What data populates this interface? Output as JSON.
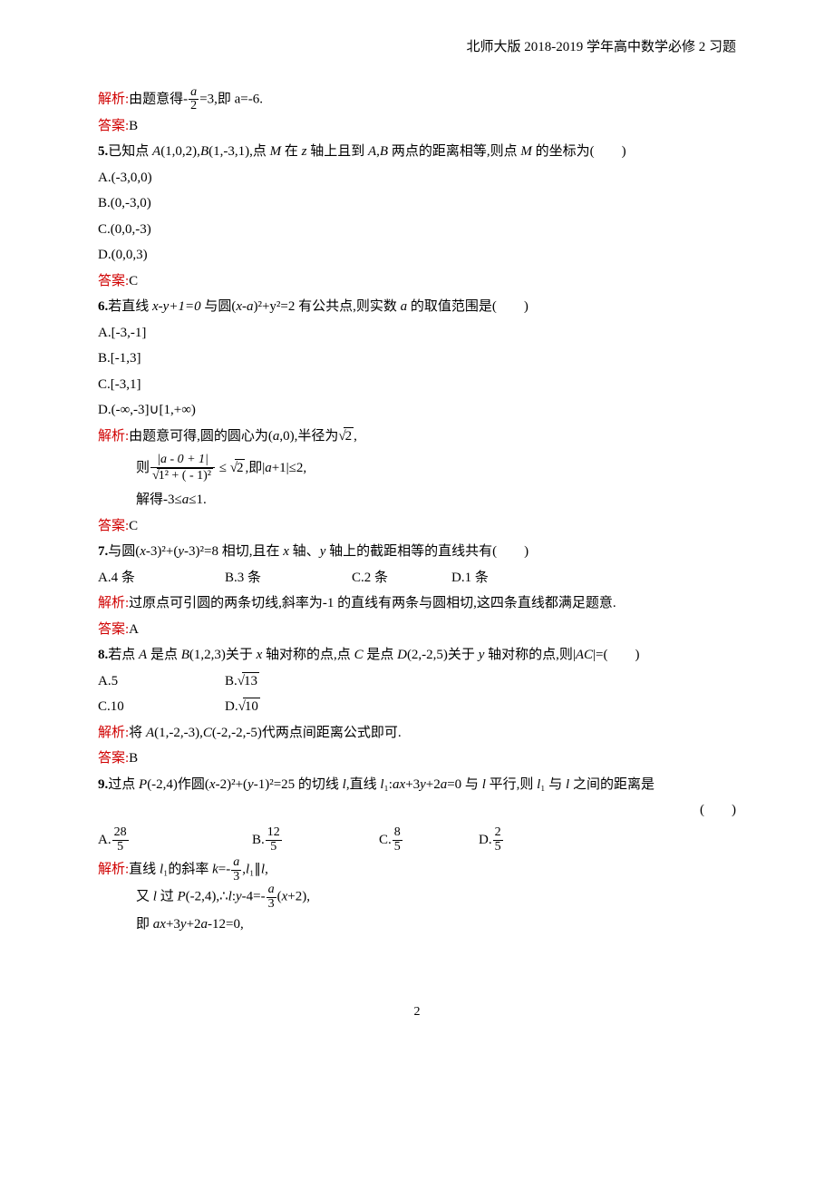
{
  "header": "北师大版 2018-2019 学年高中数学必修 2 习题",
  "q4": {
    "explain_label": "解析:",
    "explain_text_1": "由题意得-",
    "frac_num": "a",
    "frac_den": "2",
    "explain_text_2": "=3,即 a=-6.",
    "ans_label": "答案:",
    "ans_value": "B"
  },
  "q5": {
    "number": "5.",
    "stem_1": "已知点 ",
    "stem_2": "A",
    "stem_3": "(1,0,2),",
    "stem_4": "B",
    "stem_5": "(1,-3,1),点 ",
    "stem_6": "M",
    "stem_7": " 在 ",
    "stem_8": "z",
    "stem_9": " 轴上且到 ",
    "stem_10": "A,B",
    "stem_11": " 两点的距离相等,则点 ",
    "stem_12": "M",
    "stem_13": " 的坐标为(  )",
    "opt_a": "A.(-3,0,0)",
    "opt_b": "B.(0,-3,0)",
    "opt_c": "C.(0,0,-3)",
    "opt_d": "D.(0,0,3)",
    "ans_label": "答案:",
    "ans_value": "C"
  },
  "q6": {
    "number": "6.",
    "stem_pre": "若直线 ",
    "stem_eq1": "x-y+1=0",
    "stem_mid1": " 与圆(",
    "stem_eq2": "x-a",
    "stem_mid2": ")²+y²=2 有公共点,则实数 ",
    "stem_a": "a",
    "stem_post": " 的取值范围是(  )",
    "opt_a": "A.[-3,-1]",
    "opt_b": "B.[-1,3]",
    "opt_c": "C.[-3,1]",
    "opt_d": "D.(-∞,-3]∪[1,+∞)",
    "explain_label": "解析:",
    "exp_line1_a": "由题意可得,圆的圆心为(",
    "exp_line1_b": "a",
    "exp_line1_c": ",0),半径为",
    "exp_line1_sq": "2",
    "exp_line1_d": ",",
    "exp_line2_pre": "则",
    "exp_line2_num": "|a - 0 + 1|",
    "exp_line2_den_rad": "1² + ( - 1)²",
    "exp_line2_le": " ≤ ",
    "exp_line2_sq": "2",
    "exp_line2_post_a": ",即|",
    "exp_line2_post_b": "a",
    "exp_line2_post_c": "+1|≤2,",
    "exp_line3_a": "解得-3≤",
    "exp_line3_b": "a",
    "exp_line3_c": "≤1.",
    "ans_label": "答案:",
    "ans_value": "C"
  },
  "q7": {
    "number": "7.",
    "stem_pre": "与圆(",
    "stem_eq_x": "x",
    "stem_eq_1": "-3)²+(",
    "stem_eq_y": "y",
    "stem_eq_2": "-3)²=8 相切,且在 ",
    "stem_x": "x",
    "stem_mid": " 轴、",
    "stem_y": "y",
    "stem_post": " 轴上的截距相等的直线共有(  )",
    "opt_a": "A.4 条",
    "opt_b": "B.3 条",
    "opt_c": "C.2 条",
    "opt_d": "D.1 条",
    "explain_label": "解析:",
    "explain_text": "过原点可引圆的两条切线,斜率为-1 的直线有两条与圆相切,这四条直线都满足题意.",
    "ans_label": "答案:",
    "ans_value": "A"
  },
  "q8": {
    "number": "8.",
    "stem_1": "若点 ",
    "stem_A": "A",
    "stem_2": " 是点 ",
    "stem_B": "B",
    "stem_3": "(1,2,3)关于 ",
    "stem_xax": "x",
    "stem_4": " 轴对称的点,点 ",
    "stem_C": "C",
    "stem_5": " 是点 ",
    "stem_D": "D",
    "stem_6": "(2,-2,5)关于 ",
    "stem_yax": "y",
    "stem_7": " 轴对称的点,则|",
    "stem_AC": "AC",
    "stem_8": "|=(  )",
    "opt_a": "A.5",
    "opt_b_pre": "B.",
    "opt_b_rad": "13",
    "opt_c": "C.10",
    "opt_d_pre": "D.",
    "opt_d_rad": "10",
    "explain_label": "解析:",
    "explain_1": "将 ",
    "explain_A": "A",
    "explain_2": "(1,-2,-3),",
    "explain_C": "C",
    "explain_3": "(-2,-2,-5)代两点间距离公式即可.",
    "ans_label": "答案:",
    "ans_value": "B"
  },
  "q9": {
    "number": "9.",
    "stem_1": "过点 ",
    "stem_P": "P",
    "stem_2": "(-2,4)作圆(",
    "stem_x1": "x",
    "stem_3": "-2)²+(",
    "stem_y1": "y",
    "stem_4": "-1)²=25 的切线 ",
    "stem_l": "l",
    "stem_5": ",直线 ",
    "stem_l1a": "l",
    "stem_l1b": "₁",
    "stem_6": ":",
    "stem_eq_a": "ax",
    "stem_eq_b": "+3",
    "stem_eq_c": "y",
    "stem_eq_d": "+2",
    "stem_eq_e": "a",
    "stem_eq_f": "=0 与 ",
    "stem_l2": "l",
    "stem_7": " 平行,则 ",
    "stem_l1c": "l",
    "stem_l1d": "₁",
    "stem_8": " 与 ",
    "stem_l3": "l",
    "stem_9": " 之间的距离是",
    "paren": "(  )",
    "opt_a_pre": "A.",
    "opt_a_num": "28",
    "opt_a_den": "5",
    "opt_b_pre": "B.",
    "opt_b_num": "12",
    "opt_b_den": "5",
    "opt_c_pre": "C.",
    "opt_c_num": "8",
    "opt_c_den": "5",
    "opt_d_pre": "D.",
    "opt_d_num": "2",
    "opt_d_den": "5",
    "explain_label": "解析:",
    "exp1_a": "直线 ",
    "exp1_l1": "l",
    "exp1_b": "₁的斜率 ",
    "exp1_k": "k",
    "exp1_c": "=-",
    "exp1_num": "a",
    "exp1_den": "3",
    "exp1_d": ",",
    "exp1_l1b": "l",
    "exp1_e": "₁∥",
    "exp1_l": "l",
    "exp1_f": ",",
    "exp2_a": "又 ",
    "exp2_l": "l",
    "exp2_b": " 过 ",
    "exp2_P": "P",
    "exp2_c": "(-2,4),∴",
    "exp2_l2": "l",
    "exp2_d": ":",
    "exp2_y": "y",
    "exp2_e": "-4=-",
    "exp2_num": "a",
    "exp2_den": "3",
    "exp2_f": "(",
    "exp2_x": "x",
    "exp2_g": "+2),",
    "exp3_a": "即 ",
    "exp3_b": "ax",
    "exp3_c": "+3",
    "exp3_d": "y",
    "exp3_e": "+2",
    "exp3_f": "a",
    "exp3_g": "-12=0,"
  },
  "pagenum": "2"
}
